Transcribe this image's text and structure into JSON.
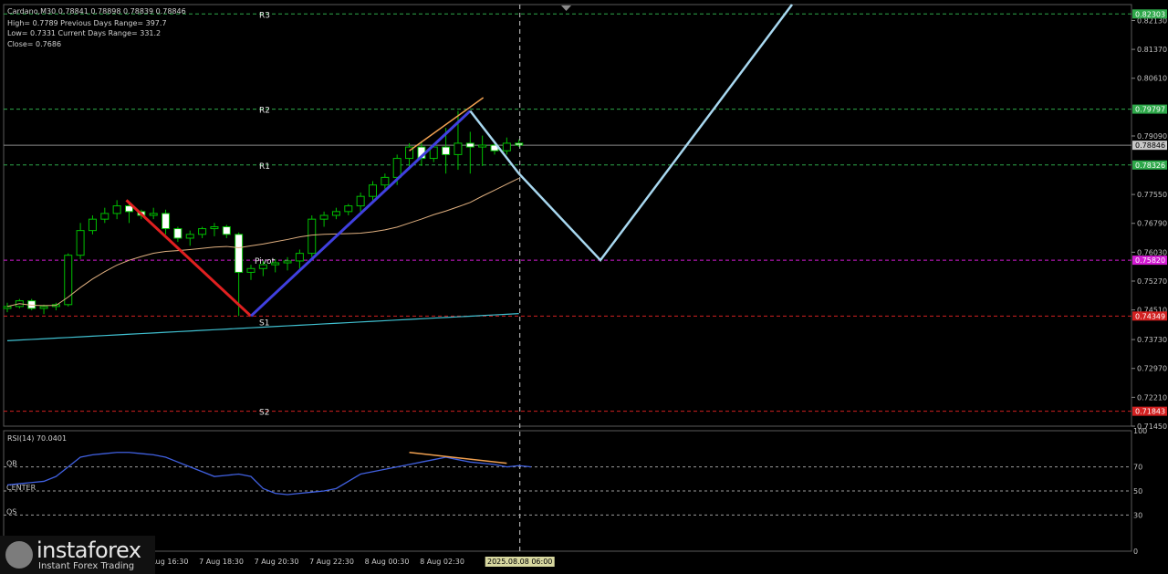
{
  "header": {
    "symbol_line": "Cardano,M30  0.78841 0.78898 0.78839 0.78846",
    "high_line": "High= 0.7789    Previous Days Range= 397.7",
    "low_line": "Low= 0.7331    Current Days Range= 331.2",
    "close_line": "Close= 0.7686"
  },
  "levels": [
    {
      "name": "R3",
      "price": "0.82303",
      "color": "#2ea84a"
    },
    {
      "name": "R2",
      "price": "0.79797",
      "color": "#2ea84a"
    },
    {
      "name": "R1",
      "price": "0.78326",
      "color": "#2ea84a"
    },
    {
      "name": "Pivot",
      "price": "0.75820",
      "color": "#d21bd2"
    },
    {
      "name": "S1",
      "price": "0.74349",
      "color": "#d22020"
    },
    {
      "name": "S2",
      "price": "0.71843",
      "color": "#d22020"
    }
  ],
  "current_price": "0.78846",
  "price_axis_ticks": [
    "0.82130",
    "0.81370",
    "0.80610",
    "0.79090",
    "0.77550",
    "0.76790",
    "0.76030",
    "0.75270",
    "0.74510",
    "0.73730",
    "0.72970",
    "0.72210",
    "0.71450"
  ],
  "rsi": {
    "title": "RSI(14) 70.0401",
    "ticks": [
      "100",
      "70",
      "50",
      "30",
      "0"
    ],
    "labels": [
      "OB",
      "CENTER",
      "OS"
    ]
  },
  "time_axis": {
    "labels": [
      "7 Aug 16:30",
      "7 Aug 18:30",
      "7 Aug 20:30",
      "7 Aug 22:30",
      "8 Aug 00:30",
      "8 Aug 02:30",
      "8"
    ],
    "crosshair_label": "2025.08.08 06:00"
  },
  "brand": {
    "name": "instaforex",
    "tagline": "Instant Forex Trading"
  },
  "colors": {
    "up_candle": "#ffffff",
    "down_candle": "#ffffff",
    "candle_wick": "#00c000",
    "ma_fast": "#e0b080",
    "ma_slow": "#40c0d0",
    "red_trend": "#e02020",
    "blue_trend": "#4040e0",
    "orange_trend": "#f0a050",
    "projection": "#a8d8f0",
    "rsi_line": "#4060e0"
  },
  "chart_data": {
    "type": "candlestick",
    "timeframe": "M30",
    "candles": [
      {
        "o": 0.7455,
        "h": 0.747,
        "l": 0.7445,
        "c": 0.746
      },
      {
        "o": 0.746,
        "h": 0.748,
        "l": 0.7455,
        "c": 0.7475
      },
      {
        "o": 0.7475,
        "h": 0.748,
        "l": 0.745,
        "c": 0.7455
      },
      {
        "o": 0.7455,
        "h": 0.7465,
        "l": 0.744,
        "c": 0.746
      },
      {
        "o": 0.746,
        "h": 0.747,
        "l": 0.745,
        "c": 0.7465
      },
      {
        "o": 0.7465,
        "h": 0.76,
        "l": 0.746,
        "c": 0.7595
      },
      {
        "o": 0.7595,
        "h": 0.768,
        "l": 0.7585,
        "c": 0.766
      },
      {
        "o": 0.766,
        "h": 0.77,
        "l": 0.765,
        "c": 0.769
      },
      {
        "o": 0.769,
        "h": 0.772,
        "l": 0.768,
        "c": 0.7705
      },
      {
        "o": 0.7705,
        "h": 0.774,
        "l": 0.769,
        "c": 0.7725
      },
      {
        "o": 0.7725,
        "h": 0.7735,
        "l": 0.768,
        "c": 0.771
      },
      {
        "o": 0.771,
        "h": 0.7715,
        "l": 0.769,
        "c": 0.77
      },
      {
        "o": 0.77,
        "h": 0.772,
        "l": 0.769,
        "c": 0.7705
      },
      {
        "o": 0.7705,
        "h": 0.7715,
        "l": 0.765,
        "c": 0.7665
      },
      {
        "o": 0.7665,
        "h": 0.767,
        "l": 0.763,
        "c": 0.764
      },
      {
        "o": 0.764,
        "h": 0.766,
        "l": 0.762,
        "c": 0.765
      },
      {
        "o": 0.765,
        "h": 0.767,
        "l": 0.764,
        "c": 0.7665
      },
      {
        "o": 0.7665,
        "h": 0.768,
        "l": 0.7645,
        "c": 0.767
      },
      {
        "o": 0.767,
        "h": 0.7675,
        "l": 0.764,
        "c": 0.765
      },
      {
        "o": 0.765,
        "h": 0.7655,
        "l": 0.7435,
        "c": 0.755
      },
      {
        "o": 0.755,
        "h": 0.757,
        "l": 0.753,
        "c": 0.756
      },
      {
        "o": 0.756,
        "h": 0.758,
        "l": 0.754,
        "c": 0.757
      },
      {
        "o": 0.757,
        "h": 0.7585,
        "l": 0.755,
        "c": 0.7575
      },
      {
        "o": 0.7575,
        "h": 0.759,
        "l": 0.7555,
        "c": 0.758
      },
      {
        "o": 0.758,
        "h": 0.761,
        "l": 0.756,
        "c": 0.76
      },
      {
        "o": 0.76,
        "h": 0.77,
        "l": 0.759,
        "c": 0.769
      },
      {
        "o": 0.769,
        "h": 0.771,
        "l": 0.767,
        "c": 0.77
      },
      {
        "o": 0.77,
        "h": 0.772,
        "l": 0.769,
        "c": 0.771
      },
      {
        "o": 0.771,
        "h": 0.773,
        "l": 0.77,
        "c": 0.7725
      },
      {
        "o": 0.7725,
        "h": 0.776,
        "l": 0.771,
        "c": 0.775
      },
      {
        "o": 0.775,
        "h": 0.779,
        "l": 0.774,
        "c": 0.778
      },
      {
        "o": 0.778,
        "h": 0.781,
        "l": 0.777,
        "c": 0.78
      },
      {
        "o": 0.78,
        "h": 0.786,
        "l": 0.778,
        "c": 0.785
      },
      {
        "o": 0.785,
        "h": 0.789,
        "l": 0.782,
        "c": 0.788
      },
      {
        "o": 0.788,
        "h": 0.7895,
        "l": 0.783,
        "c": 0.785
      },
      {
        "o": 0.785,
        "h": 0.789,
        "l": 0.784,
        "c": 0.788
      },
      {
        "o": 0.788,
        "h": 0.793,
        "l": 0.781,
        "c": 0.786
      },
      {
        "o": 0.786,
        "h": 0.7975,
        "l": 0.782,
        "c": 0.789
      },
      {
        "o": 0.789,
        "h": 0.792,
        "l": 0.781,
        "c": 0.788
      },
      {
        "o": 0.788,
        "h": 0.791,
        "l": 0.783,
        "c": 0.7885
      },
      {
        "o": 0.7885,
        "h": 0.7895,
        "l": 0.786,
        "c": 0.787
      },
      {
        "o": 0.787,
        "h": 0.7905,
        "l": 0.786,
        "c": 0.789
      },
      {
        "o": 0.789,
        "h": 0.79,
        "l": 0.788,
        "c": 0.7885
      }
    ],
    "ylim": [
      0.7145,
      0.8255
    ],
    "rsi_values": [
      55,
      56,
      57,
      58,
      62,
      70,
      78,
      80,
      81,
      82,
      82,
      81,
      80,
      78,
      74,
      70,
      66,
      62,
      63,
      64,
      62,
      52,
      48,
      47,
      48,
      49,
      50,
      52,
      58,
      64,
      66,
      68,
      70,
      72,
      74,
      76,
      78,
      76,
      74,
      73,
      72,
      70,
      71,
      70
    ],
    "rsi_ylim": [
      0,
      100
    ]
  }
}
